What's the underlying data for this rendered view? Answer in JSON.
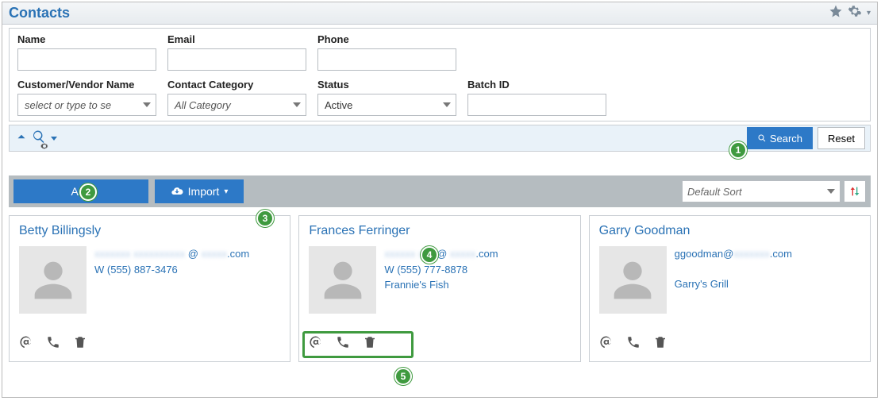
{
  "header": {
    "title": "Contacts"
  },
  "filters": {
    "name_label": "Name",
    "email_label": "Email",
    "phone_label": "Phone",
    "cv_label": "Customer/Vendor Name",
    "cv_placeholder": "select or type to se",
    "category_label": "Contact Category",
    "category_value": "All Category",
    "status_label": "Status",
    "status_value": "Active",
    "batch_label": "Batch ID"
  },
  "buttons": {
    "search": "Search",
    "reset": "Reset",
    "add": "Add",
    "import": "Import"
  },
  "sort": {
    "value": "Default Sort"
  },
  "markers": {
    "m1": "1",
    "m2": "2",
    "m3": "3",
    "m4": "4",
    "m5": "5"
  },
  "cards": [
    {
      "name": "Betty Billingsly",
      "email_suffix": ".com",
      "phone": "W (555) 887-3476",
      "company": ""
    },
    {
      "name": "Frances Ferringer",
      "email_suffix": ".com",
      "phone": "W (555) 777-8878",
      "company": "Frannie's Fish"
    },
    {
      "name": "Garry Goodman",
      "email_prefix": "ggoodman@",
      "email_suffix": ".com",
      "phone": "",
      "company": "Garry's Grill"
    }
  ]
}
